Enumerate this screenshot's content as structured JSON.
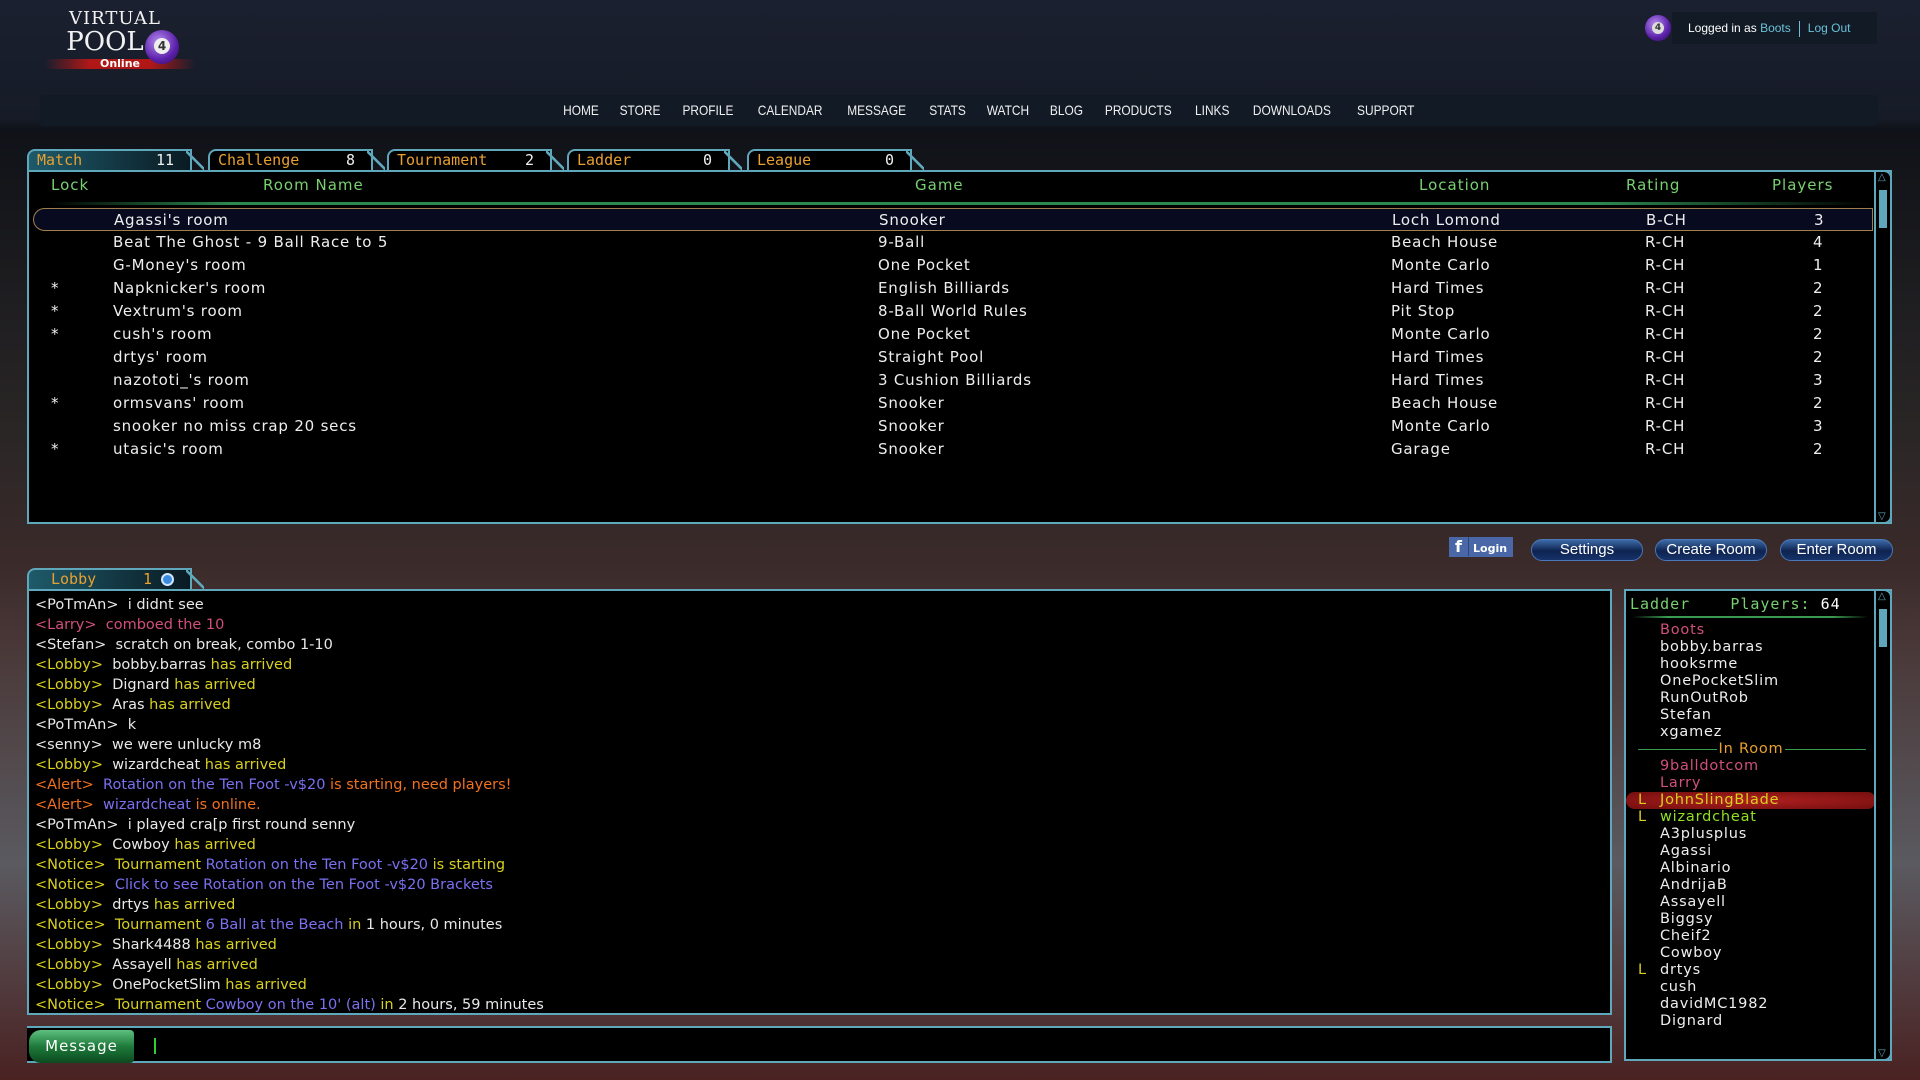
{
  "brand": {
    "line1": "Virtual",
    "line2": "Pool",
    "ball": "4",
    "line3": "Online"
  },
  "nav": [
    "HOME",
    "STORE",
    "PROFILE",
    "CALENDAR",
    "MESSAGE",
    "STATS",
    "WATCH",
    "BLOG",
    "PRODUCTS",
    "LINKS",
    "DOWNLOADS",
    "SUPPORT"
  ],
  "user": {
    "prefix": "Logged in as",
    "name": "Boots",
    "logout": "Log Out"
  },
  "tabs": [
    {
      "label": "Match",
      "count": "11",
      "active": true
    },
    {
      "label": "Challenge",
      "count": "8"
    },
    {
      "label": "Tournament",
      "count": "2"
    },
    {
      "label": "Ladder",
      "count": "0"
    },
    {
      "label": "League",
      "count": "0"
    }
  ],
  "room_table": {
    "columns": [
      "Lock",
      "Room Name",
      "Game",
      "Location",
      "Rating",
      "Players"
    ],
    "rows": [
      [
        "",
        "Agassi's room",
        "Snooker",
        "Loch Lomond",
        "B-CH",
        "3"
      ],
      [
        "",
        "Beat The Ghost - 9 Ball Race to 5",
        "9-Ball",
        "Beach House",
        "R-CH",
        "4"
      ],
      [
        "",
        "G-Money's room",
        "One Pocket",
        "Monte Carlo",
        "R-CH",
        "1"
      ],
      [
        "*",
        "Napknicker's room",
        "English Billiards",
        "Hard Times",
        "R-CH",
        "2"
      ],
      [
        "*",
        "Vextrum's room",
        "8-Ball World Rules",
        "Pit Stop",
        "R-CH",
        "2"
      ],
      [
        "*",
        "cush's room",
        "One Pocket",
        "Monte Carlo",
        "R-CH",
        "2"
      ],
      [
        "",
        "drtys' room",
        "Straight Pool",
        "Hard Times",
        "R-CH",
        "2"
      ],
      [
        "",
        "nazototi_'s room",
        "3 Cushion Billiards",
        "Hard Times",
        "R-CH",
        "3"
      ],
      [
        "*",
        "ormsvans' room",
        "Snooker",
        "Beach House",
        "R-CH",
        "2"
      ],
      [
        "",
        "snooker no miss crap 20 secs",
        "Snooker",
        "Monte Carlo",
        "R-CH",
        "3"
      ],
      [
        "*",
        "utasic's room",
        "Snooker",
        "Garage",
        "R-CH",
        "2"
      ]
    ],
    "selected_row": 0
  },
  "buttons": {
    "facebook": "Login",
    "settings": "Settings",
    "create": "Create Room",
    "enter": "Enter Room"
  },
  "lobby_tab": {
    "label": "Lobby",
    "count": "1"
  },
  "colors": {
    "white": "#e8e8e8",
    "pink": "#d0507a",
    "yellow": "#d8d020",
    "orange": "#f07020",
    "blue": "#7a70f0",
    "green": "#90e020",
    "accent": "#5fa8bc"
  },
  "chat": [
    [
      [
        "<PoTmAn>  ",
        "white"
      ],
      [
        "i didnt see",
        "white"
      ]
    ],
    [
      [
        "<Larry>  ",
        "pink"
      ],
      [
        "comboed the 10",
        "pink"
      ]
    ],
    [
      [
        "<Stefan>  ",
        "white"
      ],
      [
        "scratch on break, combo 1-10",
        "white"
      ]
    ],
    [
      [
        "<Lobby>  ",
        "yellow"
      ],
      [
        "bobby.barras ",
        "white"
      ],
      [
        "has arrived",
        "yellow"
      ]
    ],
    [
      [
        "<Lobby>  ",
        "yellow"
      ],
      [
        "Dignard ",
        "white"
      ],
      [
        "has arrived",
        "yellow"
      ]
    ],
    [
      [
        "<Lobby>  ",
        "yellow"
      ],
      [
        "Aras ",
        "white"
      ],
      [
        "has arrived",
        "yellow"
      ]
    ],
    [
      [
        "<PoTmAn>  ",
        "white"
      ],
      [
        "k",
        "white"
      ]
    ],
    [
      [
        "<senny>  ",
        "white"
      ],
      [
        "we were unlucky m8",
        "white"
      ]
    ],
    [
      [
        "<Lobby>  ",
        "yellow"
      ],
      [
        "wizardcheat ",
        "white"
      ],
      [
        "has arrived",
        "yellow"
      ]
    ],
    [
      [
        "<Alert>  ",
        "orange"
      ],
      [
        "Rotation on the Ten Foot -v$20",
        "blue"
      ],
      [
        " is starting, need players!",
        "orange"
      ]
    ],
    [
      [
        "<Alert>  ",
        "orange"
      ],
      [
        "wizardcheat",
        "blue"
      ],
      [
        " is online.",
        "orange"
      ]
    ],
    [
      [
        "<PoTmAn>  ",
        "white"
      ],
      [
        "i played cra[p first round senny",
        "white"
      ]
    ],
    [
      [
        "<Lobby>  ",
        "yellow"
      ],
      [
        "Cowboy ",
        "white"
      ],
      [
        "has arrived",
        "yellow"
      ]
    ],
    [
      [
        "<Notice>  ",
        "yellow"
      ],
      [
        "Tournament ",
        "yellow"
      ],
      [
        "Rotation on the Ten Foot -v$20",
        "blue"
      ],
      [
        " is starting",
        "yellow"
      ]
    ],
    [
      [
        "<Notice>  ",
        "yellow"
      ],
      [
        "Click to see Rotation on the Ten Foot -v$20 Brackets",
        "blue"
      ]
    ],
    [
      [
        "<Lobby>  ",
        "yellow"
      ],
      [
        "drtys ",
        "white"
      ],
      [
        "has arrived",
        "yellow"
      ]
    ],
    [
      [
        "<Notice>  ",
        "yellow"
      ],
      [
        "Tournament ",
        "yellow"
      ],
      [
        "6 Ball at the Beach",
        "blue"
      ],
      [
        " in ",
        "yellow"
      ],
      [
        "1 hours, 0 minutes",
        "white"
      ]
    ],
    [
      [
        "<Lobby>  ",
        "yellow"
      ],
      [
        "Shark4488 ",
        "white"
      ],
      [
        "has arrived",
        "yellow"
      ]
    ],
    [
      [
        "<Lobby>  ",
        "yellow"
      ],
      [
        "Assayell ",
        "white"
      ],
      [
        "has arrived",
        "yellow"
      ]
    ],
    [
      [
        "<Lobby>  ",
        "yellow"
      ],
      [
        "OnePocketSlim ",
        "white"
      ],
      [
        "has arrived",
        "yellow"
      ]
    ],
    [
      [
        "<Notice>  ",
        "yellow"
      ],
      [
        "Tournament ",
        "yellow"
      ],
      [
        "Cowboy on the 10' (alt)",
        "blue"
      ],
      [
        " in ",
        "yellow"
      ],
      [
        "2 hours, 59 minutes",
        "white"
      ]
    ]
  ],
  "message": {
    "button": "Message",
    "value": ""
  },
  "ladder": {
    "title": "Ladder",
    "players_label": "Players:",
    "players_count": "64",
    "players": [
      {
        "name": "Boots",
        "color": "pink"
      },
      {
        "name": "bobby.barras"
      },
      {
        "name": "hooksrme"
      },
      {
        "name": "OnePocketSlim"
      },
      {
        "name": "RunOutRob"
      },
      {
        "name": "Stefan"
      },
      {
        "name": "xgamez"
      },
      {
        "separator": "In Room"
      },
      {
        "name": "9balldotcom",
        "color": "pink"
      },
      {
        "name": "Larry",
        "color": "pink"
      },
      {
        "name": "JohnSlingBlade",
        "flag": "L",
        "color": "yellow",
        "highlight": true
      },
      {
        "name": "wizardcheat",
        "flag": "L",
        "color": "green"
      },
      {
        "name": "A3plusplus"
      },
      {
        "name": "Agassi"
      },
      {
        "name": "Albinario"
      },
      {
        "name": "AndrijaB"
      },
      {
        "name": "Assayell"
      },
      {
        "name": "Biggsy"
      },
      {
        "name": "Cheif2"
      },
      {
        "name": "Cowboy"
      },
      {
        "name": "drtys",
        "flag": "L"
      },
      {
        "name": "cush"
      },
      {
        "name": "davidMC1982"
      },
      {
        "name": "Dignard"
      }
    ]
  }
}
